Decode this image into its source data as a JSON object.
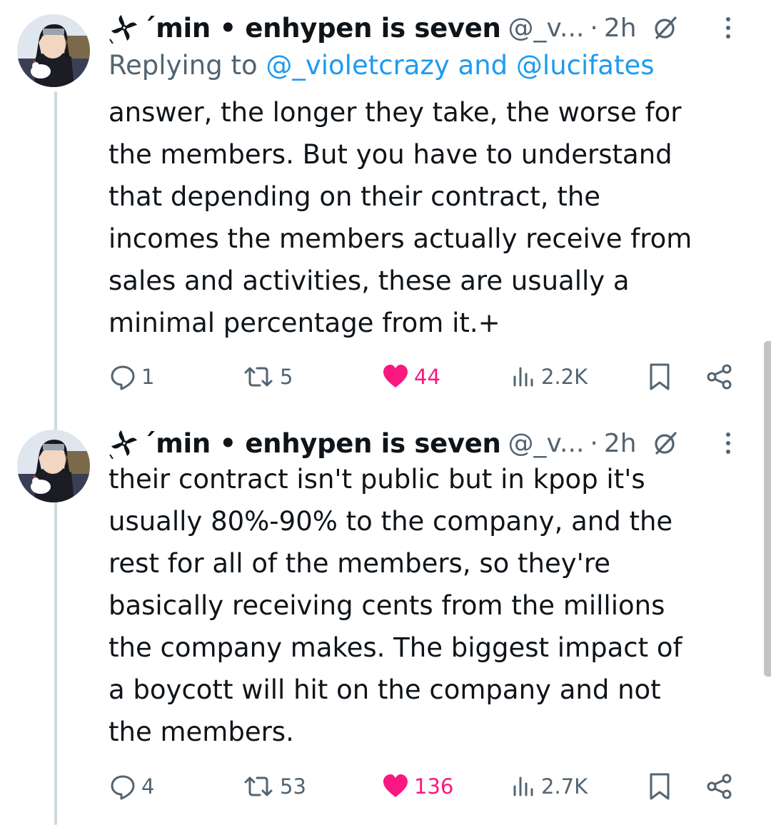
{
  "tweets": [
    {
      "author": {
        "display_name": "´min • enhypen is seven",
        "handle": "@_v...",
        "time": "2h",
        "name_icon": "pinwheel-icon"
      },
      "replying_prefix": "Replying to ",
      "replying_mention_1": "@_violetcrazy",
      "replying_and": " and ",
      "replying_mention_2": "@lucifates",
      "text": "answer, the longer they take, the worse for\nthe members. But you have to understand\nthat depending on their contract, the\nincomes the members actually receive from\nsales and activities, these are usually a\nminimal percentage from it.+",
      "stats": {
        "replies": "1",
        "reposts": "5",
        "likes": "44",
        "views": "2.2K"
      }
    },
    {
      "author": {
        "display_name": "´min • enhypen is seven",
        "handle": "@_v...",
        "time": "2h",
        "name_icon": "pinwheel-icon"
      },
      "text": "their contract isn't public but in kpop it's\nusually 80%-90% to the company, and the\nrest for all of the members, so they're\nbasically receiving cents from the millions\nthe company makes. The biggest impact of\na boycott will hit on the company and not\nthe members.",
      "stats": {
        "replies": "4",
        "reposts": "53",
        "likes": "136",
        "views": "2.7K"
      }
    }
  ],
  "colors": {
    "text": "#0f1419",
    "secondary": "#536471",
    "link": "#1d9bf0",
    "like": "#f91880",
    "thread_line": "#cfd9de"
  },
  "icons": [
    "pinwheel-icon",
    "grok-icon",
    "more-icon",
    "reply-icon",
    "repost-icon",
    "heart-icon",
    "views-icon",
    "bookmark-icon",
    "share-icon"
  ]
}
